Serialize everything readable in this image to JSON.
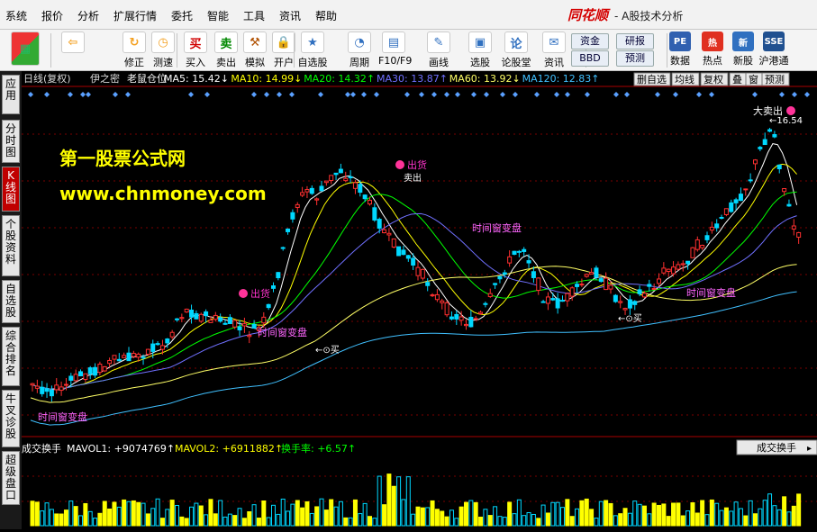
{
  "menu": [
    "系统",
    "报价",
    "分析",
    "扩展行情",
    "委托",
    "智能",
    "工具",
    "资讯",
    "帮助"
  ],
  "brand": "同花顺",
  "app_title": "A股技术分析",
  "toolbar": {
    "buttons": [
      {
        "label": "",
        "icon": "grid-icon",
        "color": "#2b6"
      },
      {
        "label": "",
        "icon": "back-arrow-icon",
        "color": "#f4a020"
      },
      {
        "label": "修正",
        "icon": "refresh-icon",
        "color": "#f4a020"
      },
      {
        "label": "测速",
        "icon": "clock-icon",
        "color": "#f4a020"
      },
      {
        "label": "买入",
        "icon": "buy-icon",
        "glyph": "买",
        "color": "#d00000"
      },
      {
        "label": "卖出",
        "icon": "sell-icon",
        "glyph": "卖",
        "color": "#008800"
      },
      {
        "label": "模拟",
        "icon": "hammer-icon",
        "color": "#b05000"
      },
      {
        "label": "开户",
        "icon": "lock-icon",
        "color": "#888"
      },
      {
        "label": "自选股",
        "icon": "star-icon",
        "color": "#3070c0"
      },
      {
        "label": "周期",
        "icon": "cycle-icon",
        "color": "#3070c0"
      },
      {
        "label": "F10/F9",
        "icon": "f10-icon",
        "color": "#3070c0"
      },
      {
        "label": "画线",
        "icon": "pencil-icon",
        "color": "#3070c0"
      },
      {
        "label": "选股",
        "icon": "select-stock-icon",
        "color": "#3070c0"
      },
      {
        "label": "论股堂",
        "icon": "discuss-icon",
        "glyph": "论",
        "color": "#3070c0"
      },
      {
        "label": "资讯",
        "icon": "info-icon",
        "color": "#3070c0"
      }
    ],
    "small_buttons": [
      "资金",
      "研报",
      "BBD",
      "预测"
    ],
    "right_buttons": [
      {
        "label": "数据",
        "icon": "pe-icon",
        "glyph": "PE"
      },
      {
        "label": "热点",
        "icon": "hot-icon",
        "glyph": "热"
      },
      {
        "label": "新股",
        "icon": "newstock-icon",
        "glyph": "新"
      },
      {
        "label": "沪港通",
        "icon": "shhk-icon",
        "glyph": "SSE"
      }
    ]
  },
  "side_tabs": [
    "应用",
    "分时图",
    "K线图",
    "个股资料",
    "自选股",
    "综合排名",
    "牛叉诊股",
    "超级盘口"
  ],
  "active_side_tab": "K线图",
  "chart_header": {
    "period": "日线(复权)",
    "formula": "伊之密",
    "indicator": "老鼠仓位",
    "ma": [
      {
        "label": "MA5: 15.42↓",
        "color": "#ffffff"
      },
      {
        "label": "MA10: 14.99↓",
        "color": "#ffff00"
      },
      {
        "label": "MA20: 14.32↑",
        "color": "#00ff00"
      },
      {
        "label": "MA30: 13.87↑",
        "color": "#7070ff"
      },
      {
        "label": "MA60: 13.92↓",
        "color": "#ffff66"
      },
      {
        "label": "MA120: 12.83↑",
        "color": "#40c0ff"
      }
    ],
    "buttons": [
      "删自选",
      "均线",
      "复权",
      "叠",
      "窗",
      "预测"
    ]
  },
  "watermark": {
    "line1": "第一股票公式网",
    "line2": "www.chnmoney.com"
  },
  "annotations": {
    "sell": "出货",
    "buy": "买",
    "time_window": "时间窗变盘",
    "big_sell": "大卖出",
    "sell2": "卖出",
    "high_price": "16.54"
  },
  "volume_header": {
    "name": "成交换手",
    "mavol1": "MAVOL1: +9074769↑",
    "mavol2": "MAVOL2: +6911882↑",
    "turnover": "换手率: +6.57↑",
    "dropdown": "成交换手"
  },
  "colors": {
    "up": "#ff3030",
    "down": "#00d8ff",
    "volume": "#ffff00",
    "ma5": "#ffffff",
    "ma10": "#ffff00",
    "ma20": "#00ff00",
    "ma30": "#7070ff",
    "ma60": "#ffff66",
    "ma120": "#40c0ff",
    "accent": "#ff00ff"
  }
}
